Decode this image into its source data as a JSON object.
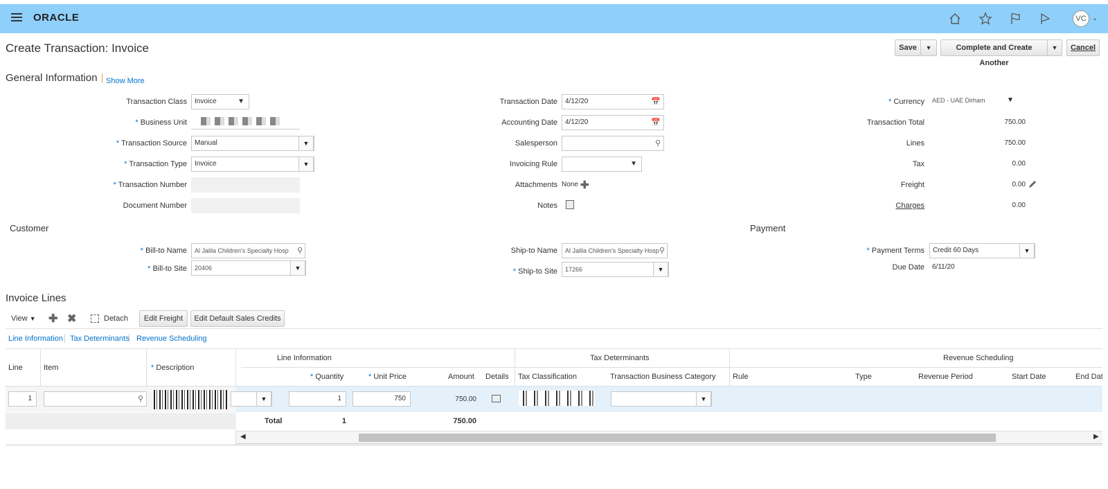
{
  "header": {
    "logo": "ORACLE",
    "avatar_initials": "VC",
    "icons": [
      "menu-icon",
      "home-icon",
      "star-icon",
      "flag-icon",
      "notifications-flag-icon"
    ]
  },
  "page": {
    "title": "Create Transaction: Invoice",
    "save_label": "Save",
    "complete_label": "Complete and Create Another",
    "cancel_label": "Cancel"
  },
  "general": {
    "heading": "General Information",
    "show_more": "Show More",
    "transaction_class_label": "Transaction Class",
    "transaction_class_value": "Invoice",
    "business_unit_label": "Business Unit",
    "transaction_source_label": "Transaction Source",
    "transaction_source_value": "Manual",
    "transaction_type_label": "Transaction Type",
    "transaction_type_value": "Invoice",
    "transaction_number_label": "Transaction Number",
    "document_number_label": "Document Number",
    "transaction_date_label": "Transaction Date",
    "transaction_date_value": "4/12/20",
    "accounting_date_label": "Accounting Date",
    "accounting_date_value": "4/12/20",
    "salesperson_label": "Salesperson",
    "invoicing_rule_label": "Invoicing Rule",
    "attachments_label": "Attachments",
    "attachments_value": "None",
    "notes_label": "Notes",
    "currency_label": "Currency",
    "currency_value": "AED - UAE Dirham",
    "transaction_total_label": "Transaction Total",
    "transaction_total_value": "750.00",
    "lines_label": "Lines",
    "lines_value": "750.00",
    "tax_label": "Tax",
    "tax_value": "0.00",
    "freight_label": "Freight",
    "freight_value": "0.00",
    "charges_label": "Charges",
    "charges_value": "0.00"
  },
  "customer": {
    "heading": "Customer",
    "bill_to_name_label": "Bill-to Name",
    "bill_to_name_value": "Al Jalila Children's Specialty Hosp",
    "bill_to_site_label": "Bill-to Site",
    "bill_to_site_value": "20406",
    "ship_to_name_label": "Ship-to Name",
    "ship_to_name_value": "Al Jalila Children's Specialty Hosp",
    "ship_to_site_label": "Ship-to Site",
    "ship_to_site_value": "17266"
  },
  "payment": {
    "heading": "Payment",
    "payment_terms_label": "Payment Terms",
    "payment_terms_value": "Credit 60 Days",
    "due_date_label": "Due Date",
    "due_date_value": "6/11/20"
  },
  "invoice_lines": {
    "heading": "Invoice Lines",
    "view_label": "View",
    "detach_label": "Detach",
    "edit_freight_label": "Edit Freight",
    "edit_sales_credits_label": "Edit Default Sales Credits",
    "tabs": [
      "Line Information",
      "Tax Determinants",
      "Revenue Scheduling"
    ],
    "group_headers": [
      "Line Information",
      "Tax Determinants",
      "Revenue Scheduling"
    ],
    "columns": {
      "line": "Line",
      "item": "Item",
      "description": "Description",
      "quantity": "Quantity",
      "unit_price": "Unit Price",
      "amount": "Amount",
      "details": "Details",
      "tax_classification": "Tax Classification",
      "transaction_business_category": "Transaction Business Category",
      "rule": "Rule",
      "type": "Type",
      "revenue_period": "Revenue Period",
      "start_date": "Start Date",
      "end_date": "End Dat"
    },
    "row": {
      "line": "1",
      "quantity": "1",
      "unit_price": "750",
      "amount": "750.00"
    },
    "total": {
      "label": "Total",
      "quantity": "1",
      "amount": "750.00"
    }
  }
}
